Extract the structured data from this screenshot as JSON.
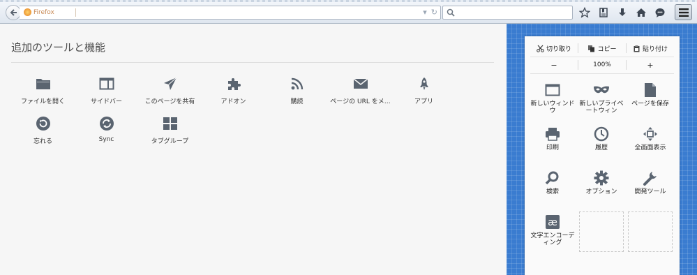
{
  "urlbar": {
    "identity_label": "Firefox"
  },
  "main": {
    "title": "追加のツールと機能",
    "tools": [
      {
        "label": "ファイルを開く",
        "icon": "folder-icon"
      },
      {
        "label": "サイドバー",
        "icon": "sidebar-icon"
      },
      {
        "label": "このページを共有",
        "icon": "share-icon"
      },
      {
        "label": "アドオン",
        "icon": "puzzle-icon"
      },
      {
        "label": "購読",
        "icon": "rss-icon"
      },
      {
        "label": "ページの URL をメ…",
        "icon": "mail-icon"
      },
      {
        "label": "アプリ",
        "icon": "rocket-icon"
      },
      {
        "label": "忘れる",
        "icon": "forget-icon"
      },
      {
        "label": "Sync",
        "icon": "sync-icon"
      },
      {
        "label": "タブグループ",
        "icon": "tab-groups-icon"
      }
    ]
  },
  "panel": {
    "edit": {
      "cut": "切り取り",
      "copy": "コピー",
      "paste": "貼り付け"
    },
    "zoom": {
      "out": "−",
      "level": "100%",
      "in": "+"
    },
    "items": [
      {
        "label": "新しいウィンドウ",
        "icon": "new-window-icon"
      },
      {
        "label": "新しいプライベートウィン",
        "icon": "private-mask-icon"
      },
      {
        "label": "ページを保存",
        "icon": "save-page-icon"
      },
      {
        "label": "印刷",
        "icon": "print-icon"
      },
      {
        "label": "履歴",
        "icon": "history-icon"
      },
      {
        "label": "全画面表示",
        "icon": "fullscreen-icon"
      },
      {
        "label": "検索",
        "icon": "search-icon"
      },
      {
        "label": "オプション",
        "icon": "gear-icon"
      },
      {
        "label": "開発ツール",
        "icon": "wrench-icon"
      },
      {
        "label": "文字エンコーディング",
        "icon": "encoding-icon"
      }
    ]
  },
  "colors": {
    "accent_blue": "#3a7cd0",
    "icon_gray": "#5a6470"
  }
}
